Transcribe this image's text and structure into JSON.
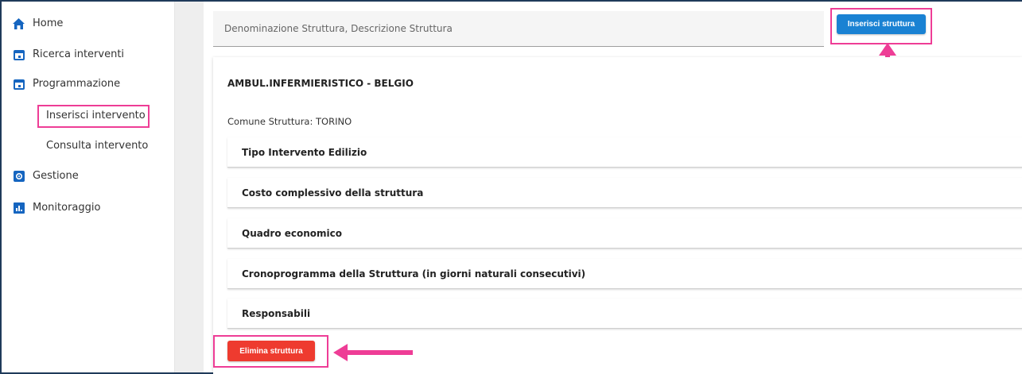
{
  "sidebar": {
    "items": [
      {
        "label": "Home",
        "icon": "home-icon"
      },
      {
        "label": "Ricerca interventi",
        "icon": "calendar-icon"
      },
      {
        "label": "Programmazione",
        "icon": "calendar-icon"
      },
      {
        "label": "Gestione",
        "icon": "settings-icon"
      },
      {
        "label": "Monitoraggio",
        "icon": "chart-icon"
      }
    ],
    "subitems": [
      {
        "label": "Inserisci intervento"
      },
      {
        "label": "Consulta intervento"
      }
    ]
  },
  "search": {
    "placeholder": "Denominazione Struttura, Descrizione Struttura"
  },
  "toolbar": {
    "insert_label": "Inserisci struttura"
  },
  "structure": {
    "title": "AMBUL.INFERMIERISTICO - BELGIO",
    "comune": "Comune Struttura: TORINO",
    "sections": [
      {
        "label": "Tipo Intervento Edilizio"
      },
      {
        "label": "Costo complessivo della struttura"
      },
      {
        "label": "Quadro economico"
      },
      {
        "label": "Cronoprogramma della Struttura (in giorni naturali consecutivi)"
      },
      {
        "label": "Responsabili"
      }
    ],
    "delete_label": "Elimina struttura"
  },
  "colors": {
    "primary": "#1a82d3",
    "danger": "#ee3b2f",
    "highlight": "#ee3d96",
    "nav_icon": "#1565c0"
  }
}
